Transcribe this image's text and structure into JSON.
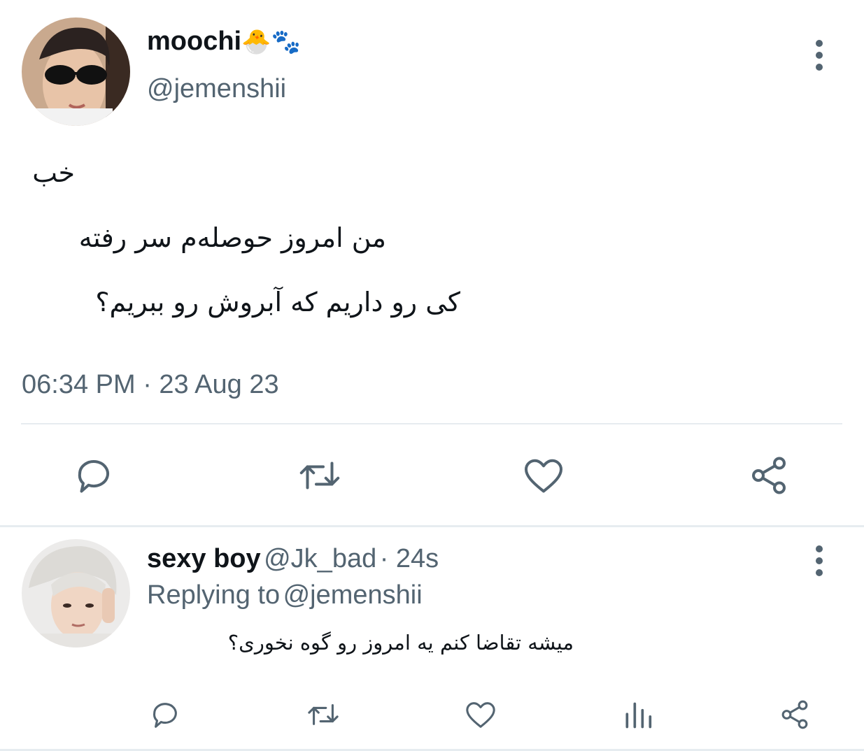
{
  "tweet": {
    "author_name": "moochi",
    "author_emoji": "🐣🐾",
    "author_handle": "@jemenshii",
    "lines": [
      "خب",
      "من امروز حوصله‌م سر رفته",
      "کی رو داریم که آبروش رو ببریم؟"
    ],
    "timestamp": "06:34 PM · 23 Aug 23",
    "actions": [
      "reply-icon",
      "retweet-icon",
      "like-icon",
      "share-icon"
    ]
  },
  "reply": {
    "author_name": "sexy boy",
    "author_handle": "@Jk_bad",
    "time": "· 24s",
    "replying_prefix": "Replying to",
    "replying_to": "@jemenshii",
    "text": "میشه تقاضا کنم یه امروز رو گوه نخوری؟",
    "actions": [
      "reply-icon",
      "retweet-icon",
      "like-icon",
      "views-icon",
      "share-icon"
    ]
  },
  "colors": {
    "text": "#0f1419",
    "secondary": "#536471",
    "link": "#1d9bf0",
    "divider": "#e6ecf0"
  }
}
